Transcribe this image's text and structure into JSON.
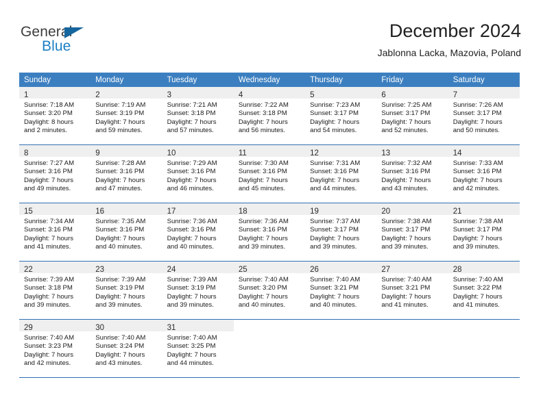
{
  "brand": {
    "logo_text_primary": "General",
    "logo_text_secondary": "Blue",
    "logo_icon": "triangle-flag-icon"
  },
  "header": {
    "month_title": "December 2024",
    "location": "Jablonna Lacka, Mazovia, Poland"
  },
  "colors": {
    "header_blue": "#3c7fc0",
    "separator_blue": "#2f6fb0",
    "datenum_band": "#efefef",
    "logo_blue": "#1b7ec4"
  },
  "calendar": {
    "weekday_headers": [
      "Sunday",
      "Monday",
      "Tuesday",
      "Wednesday",
      "Thursday",
      "Friday",
      "Saturday"
    ],
    "weeks": [
      [
        {
          "day": "1",
          "sunrise": "Sunrise: 7:18 AM",
          "sunset": "Sunset: 3:20 PM",
          "daylight_line1": "Daylight: 8 hours",
          "daylight_line2": "and 2 minutes."
        },
        {
          "day": "2",
          "sunrise": "Sunrise: 7:19 AM",
          "sunset": "Sunset: 3:19 PM",
          "daylight_line1": "Daylight: 7 hours",
          "daylight_line2": "and 59 minutes."
        },
        {
          "day": "3",
          "sunrise": "Sunrise: 7:21 AM",
          "sunset": "Sunset: 3:18 PM",
          "daylight_line1": "Daylight: 7 hours",
          "daylight_line2": "and 57 minutes."
        },
        {
          "day": "4",
          "sunrise": "Sunrise: 7:22 AM",
          "sunset": "Sunset: 3:18 PM",
          "daylight_line1": "Daylight: 7 hours",
          "daylight_line2": "and 56 minutes."
        },
        {
          "day": "5",
          "sunrise": "Sunrise: 7:23 AM",
          "sunset": "Sunset: 3:17 PM",
          "daylight_line1": "Daylight: 7 hours",
          "daylight_line2": "and 54 minutes."
        },
        {
          "day": "6",
          "sunrise": "Sunrise: 7:25 AM",
          "sunset": "Sunset: 3:17 PM",
          "daylight_line1": "Daylight: 7 hours",
          "daylight_line2": "and 52 minutes."
        },
        {
          "day": "7",
          "sunrise": "Sunrise: 7:26 AM",
          "sunset": "Sunset: 3:17 PM",
          "daylight_line1": "Daylight: 7 hours",
          "daylight_line2": "and 50 minutes."
        }
      ],
      [
        {
          "day": "8",
          "sunrise": "Sunrise: 7:27 AM",
          "sunset": "Sunset: 3:16 PM",
          "daylight_line1": "Daylight: 7 hours",
          "daylight_line2": "and 49 minutes."
        },
        {
          "day": "9",
          "sunrise": "Sunrise: 7:28 AM",
          "sunset": "Sunset: 3:16 PM",
          "daylight_line1": "Daylight: 7 hours",
          "daylight_line2": "and 47 minutes."
        },
        {
          "day": "10",
          "sunrise": "Sunrise: 7:29 AM",
          "sunset": "Sunset: 3:16 PM",
          "daylight_line1": "Daylight: 7 hours",
          "daylight_line2": "and 46 minutes."
        },
        {
          "day": "11",
          "sunrise": "Sunrise: 7:30 AM",
          "sunset": "Sunset: 3:16 PM",
          "daylight_line1": "Daylight: 7 hours",
          "daylight_line2": "and 45 minutes."
        },
        {
          "day": "12",
          "sunrise": "Sunrise: 7:31 AM",
          "sunset": "Sunset: 3:16 PM",
          "daylight_line1": "Daylight: 7 hours",
          "daylight_line2": "and 44 minutes."
        },
        {
          "day": "13",
          "sunrise": "Sunrise: 7:32 AM",
          "sunset": "Sunset: 3:16 PM",
          "daylight_line1": "Daylight: 7 hours",
          "daylight_line2": "and 43 minutes."
        },
        {
          "day": "14",
          "sunrise": "Sunrise: 7:33 AM",
          "sunset": "Sunset: 3:16 PM",
          "daylight_line1": "Daylight: 7 hours",
          "daylight_line2": "and 42 minutes."
        }
      ],
      [
        {
          "day": "15",
          "sunrise": "Sunrise: 7:34 AM",
          "sunset": "Sunset: 3:16 PM",
          "daylight_line1": "Daylight: 7 hours",
          "daylight_line2": "and 41 minutes."
        },
        {
          "day": "16",
          "sunrise": "Sunrise: 7:35 AM",
          "sunset": "Sunset: 3:16 PM",
          "daylight_line1": "Daylight: 7 hours",
          "daylight_line2": "and 40 minutes."
        },
        {
          "day": "17",
          "sunrise": "Sunrise: 7:36 AM",
          "sunset": "Sunset: 3:16 PM",
          "daylight_line1": "Daylight: 7 hours",
          "daylight_line2": "and 40 minutes."
        },
        {
          "day": "18",
          "sunrise": "Sunrise: 7:36 AM",
          "sunset": "Sunset: 3:16 PM",
          "daylight_line1": "Daylight: 7 hours",
          "daylight_line2": "and 39 minutes."
        },
        {
          "day": "19",
          "sunrise": "Sunrise: 7:37 AM",
          "sunset": "Sunset: 3:17 PM",
          "daylight_line1": "Daylight: 7 hours",
          "daylight_line2": "and 39 minutes."
        },
        {
          "day": "20",
          "sunrise": "Sunrise: 7:38 AM",
          "sunset": "Sunset: 3:17 PM",
          "daylight_line1": "Daylight: 7 hours",
          "daylight_line2": "and 39 minutes."
        },
        {
          "day": "21",
          "sunrise": "Sunrise: 7:38 AM",
          "sunset": "Sunset: 3:17 PM",
          "daylight_line1": "Daylight: 7 hours",
          "daylight_line2": "and 39 minutes."
        }
      ],
      [
        {
          "day": "22",
          "sunrise": "Sunrise: 7:39 AM",
          "sunset": "Sunset: 3:18 PM",
          "daylight_line1": "Daylight: 7 hours",
          "daylight_line2": "and 39 minutes."
        },
        {
          "day": "23",
          "sunrise": "Sunrise: 7:39 AM",
          "sunset": "Sunset: 3:19 PM",
          "daylight_line1": "Daylight: 7 hours",
          "daylight_line2": "and 39 minutes."
        },
        {
          "day": "24",
          "sunrise": "Sunrise: 7:39 AM",
          "sunset": "Sunset: 3:19 PM",
          "daylight_line1": "Daylight: 7 hours",
          "daylight_line2": "and 39 minutes."
        },
        {
          "day": "25",
          "sunrise": "Sunrise: 7:40 AM",
          "sunset": "Sunset: 3:20 PM",
          "daylight_line1": "Daylight: 7 hours",
          "daylight_line2": "and 40 minutes."
        },
        {
          "day": "26",
          "sunrise": "Sunrise: 7:40 AM",
          "sunset": "Sunset: 3:21 PM",
          "daylight_line1": "Daylight: 7 hours",
          "daylight_line2": "and 40 minutes."
        },
        {
          "day": "27",
          "sunrise": "Sunrise: 7:40 AM",
          "sunset": "Sunset: 3:21 PM",
          "daylight_line1": "Daylight: 7 hours",
          "daylight_line2": "and 41 minutes."
        },
        {
          "day": "28",
          "sunrise": "Sunrise: 7:40 AM",
          "sunset": "Sunset: 3:22 PM",
          "daylight_line1": "Daylight: 7 hours",
          "daylight_line2": "and 41 minutes."
        }
      ],
      [
        {
          "day": "29",
          "sunrise": "Sunrise: 7:40 AM",
          "sunset": "Sunset: 3:23 PM",
          "daylight_line1": "Daylight: 7 hours",
          "daylight_line2": "and 42 minutes."
        },
        {
          "day": "30",
          "sunrise": "Sunrise: 7:40 AM",
          "sunset": "Sunset: 3:24 PM",
          "daylight_line1": "Daylight: 7 hours",
          "daylight_line2": "and 43 minutes."
        },
        {
          "day": "31",
          "sunrise": "Sunrise: 7:40 AM",
          "sunset": "Sunset: 3:25 PM",
          "daylight_line1": "Daylight: 7 hours",
          "daylight_line2": "and 44 minutes."
        },
        {
          "day": "",
          "sunrise": "",
          "sunset": "",
          "daylight_line1": "",
          "daylight_line2": ""
        },
        {
          "day": "",
          "sunrise": "",
          "sunset": "",
          "daylight_line1": "",
          "daylight_line2": ""
        },
        {
          "day": "",
          "sunrise": "",
          "sunset": "",
          "daylight_line1": "",
          "daylight_line2": ""
        },
        {
          "day": "",
          "sunrise": "",
          "sunset": "",
          "daylight_line1": "",
          "daylight_line2": ""
        }
      ]
    ]
  }
}
